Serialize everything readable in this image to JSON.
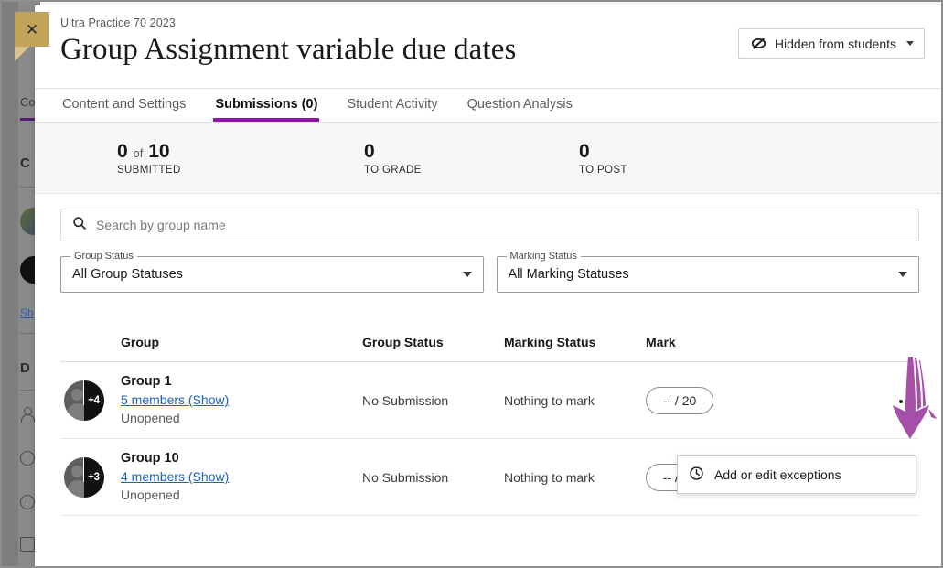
{
  "header": {
    "breadcrumb": "Ultra Practice 70 2023",
    "title": "Group Assignment variable due dates",
    "visibility_label": "Hidden from students",
    "close_label": "✕"
  },
  "tabs": [
    {
      "label": "Content and Settings",
      "active": false
    },
    {
      "label": "Submissions (0)",
      "active": true
    },
    {
      "label": "Student Activity",
      "active": false
    },
    {
      "label": "Question Analysis",
      "active": false
    }
  ],
  "stats": [
    {
      "value": "0",
      "of": "of",
      "total": "10",
      "label": "SUBMITTED"
    },
    {
      "value": "0",
      "label": "TO GRADE"
    },
    {
      "value": "0",
      "label": "TO POST"
    }
  ],
  "search": {
    "placeholder": "Search by group name",
    "value": ""
  },
  "filters": [
    {
      "legend": "Group Status",
      "value": "All Group Statuses"
    },
    {
      "legend": "Marking Status",
      "value": "All Marking Statuses"
    }
  ],
  "table": {
    "columns": [
      "Group",
      "Group Status",
      "Marking Status",
      "Mark"
    ],
    "rows": [
      {
        "avatar_count": "+4",
        "group": "Group 1",
        "members": "5 members (Show)",
        "opened_status": "Unopened",
        "group_status": "No Submission",
        "marking_status": "Nothing to mark",
        "mark": "-- / 20"
      },
      {
        "avatar_count": "+3",
        "group": "Group 10",
        "members": "4 members (Show)",
        "opened_status": "Unopened",
        "group_status": "No Submission",
        "marking_status": "Nothing to mark",
        "mark": "-- / 20"
      }
    ]
  },
  "menu": {
    "items": [
      {
        "label": "Add or edit exceptions",
        "icon": "clock-icon"
      }
    ]
  },
  "background": {
    "fragments": [
      "Co",
      "C",
      "Sh",
      "D"
    ]
  },
  "colors": {
    "accent_purple": "#9013aa",
    "annotation_purple": "#a54fa8",
    "link_blue": "#1a62bd",
    "close_badge_gold": "#c3a259",
    "stats_bg": "#f7f7f7"
  }
}
